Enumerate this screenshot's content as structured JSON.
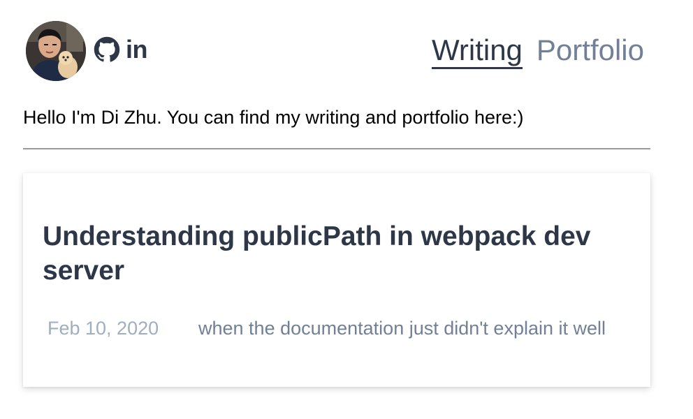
{
  "header": {
    "social": {
      "github_icon": "github-icon",
      "linkedin_label": "in"
    },
    "nav": {
      "writing_label": "Writing",
      "portfolio_label": "Portfolio"
    }
  },
  "intro": {
    "text": "Hello I'm Di Zhu. You can find my writing and portfolio here:)"
  },
  "posts": [
    {
      "title": "Understanding publicPath in webpack dev server",
      "date": "Feb 10, 2020",
      "description": "when the documentation just didn't explain it well"
    }
  ],
  "colors": {
    "heading": "#2d3748",
    "muted": "#718096",
    "date": "#a0aec0",
    "divider": "#9a9a9a"
  }
}
